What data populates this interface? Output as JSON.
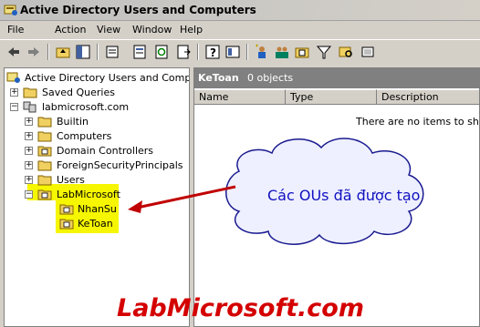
{
  "window": {
    "title": "Active Directory Users and Computers"
  },
  "menu": [
    "File",
    "Action",
    "View",
    "Window",
    "Help"
  ],
  "toolbar": {
    "buttons": [
      "back-icon",
      "forward-icon",
      "up-folder-icon",
      "show-tree-icon",
      "console-tree-icon",
      "properties-icon",
      "refresh-icon",
      "export-list-icon",
      "help-icon",
      "view-icon",
      "new-user-icon",
      "new-group-icon",
      "new-ou-icon",
      "filter-icon",
      "find-icon",
      "add-to-group-icon"
    ]
  },
  "tree": {
    "root": "Active Directory Users and Computer",
    "saved_queries": "Saved Queries",
    "domain": "labmicrosoft.com",
    "children": [
      "Builtin",
      "Computers",
      "Domain Controllers",
      "ForeignSecurityPrincipals",
      "Users"
    ],
    "ou_parent": "LabMicrosoft",
    "ous": [
      "NhanSu",
      "KeToan"
    ]
  },
  "detail": {
    "title": "KeToan",
    "count": "0 objects",
    "columns": [
      "Name",
      "Type",
      "Description"
    ],
    "empty_message": "There are no items to show i"
  },
  "annotation": {
    "text": "Các OUs đã được tạo"
  },
  "watermark": "LabMicrosoft.com",
  "colors": {
    "highlight": "#f6f600",
    "annotation_text": "#1010c0",
    "watermark": "#d40000",
    "arrow": "#c00000"
  }
}
